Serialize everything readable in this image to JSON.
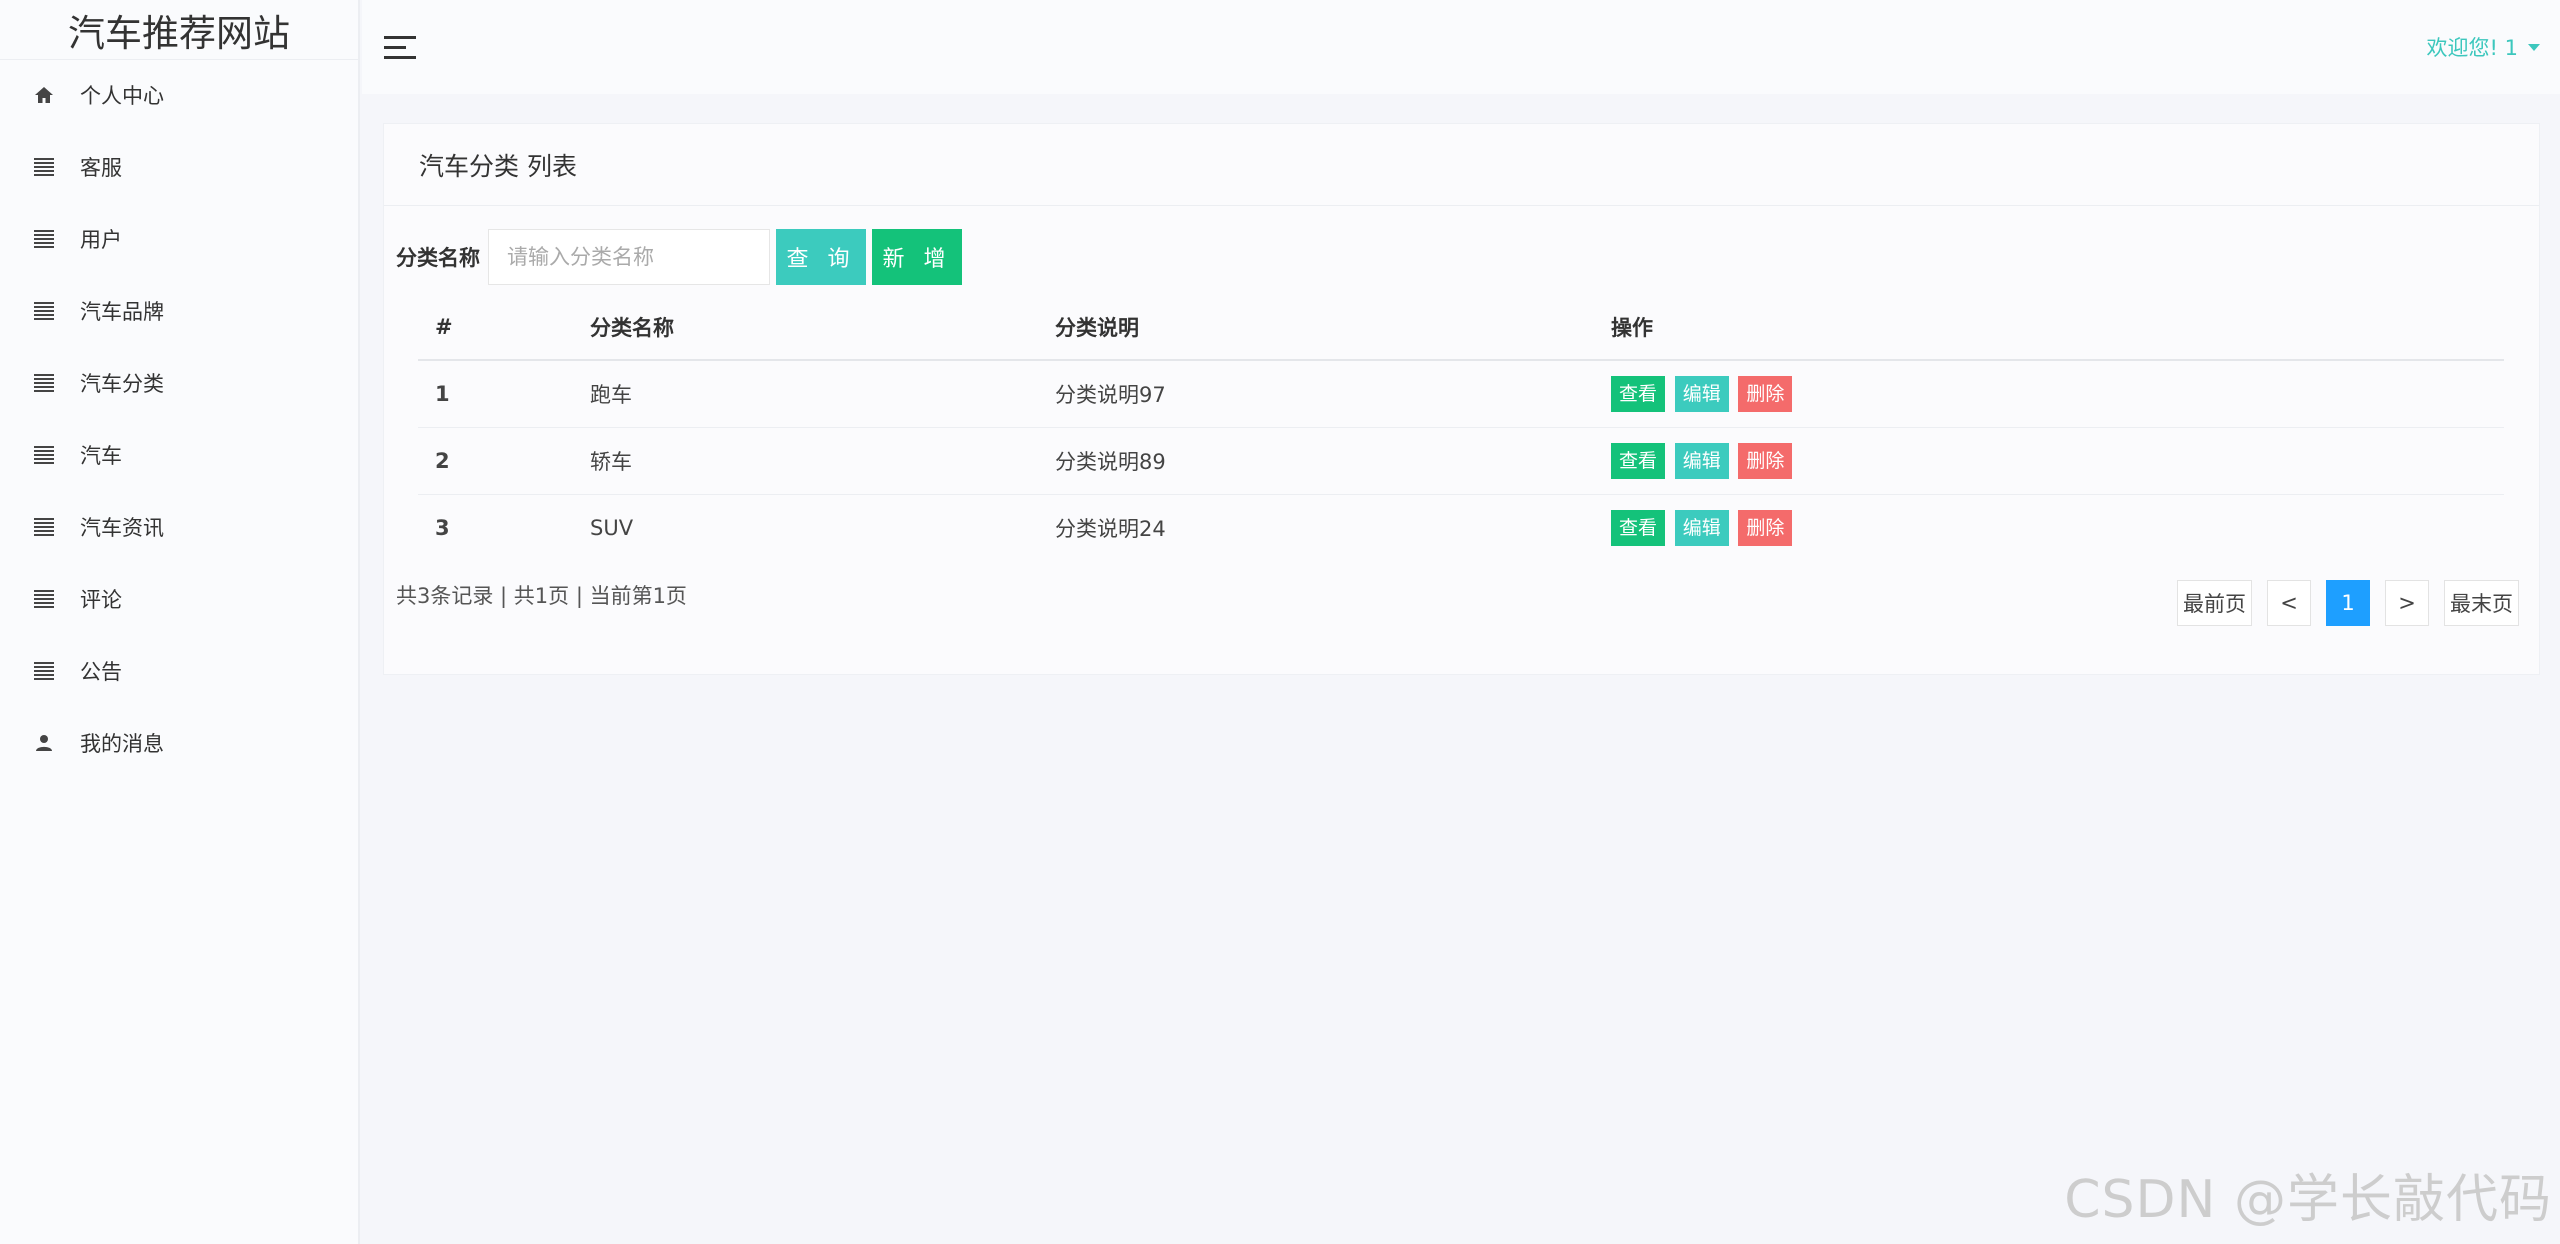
{
  "brand": {
    "title": "汽车推荐网站"
  },
  "sidebar": {
    "items": [
      {
        "label": "个人中心",
        "icon": "home-icon"
      },
      {
        "label": "客服",
        "icon": "list-icon"
      },
      {
        "label": "用户",
        "icon": "list-icon"
      },
      {
        "label": "汽车品牌",
        "icon": "list-icon"
      },
      {
        "label": "汽车分类",
        "icon": "list-icon"
      },
      {
        "label": "汽车",
        "icon": "list-icon"
      },
      {
        "label": "汽车资讯",
        "icon": "list-icon"
      },
      {
        "label": "评论",
        "icon": "list-icon"
      },
      {
        "label": "公告",
        "icon": "list-icon"
      },
      {
        "label": "我的消息",
        "icon": "user-icon"
      }
    ]
  },
  "header": {
    "menu_icon": "hamburger-icon",
    "welcome": "欢迎您! 1",
    "accent": "#3cc7bd"
  },
  "main": {
    "title": "汽车分类 列表",
    "search": {
      "label": "分类名称",
      "placeholder": "请输入分类名称",
      "value": "",
      "query_label": "查 询",
      "add_label": "新 增"
    },
    "table": {
      "headers": [
        "#",
        "分类名称",
        "分类说明",
        "操作"
      ],
      "rows": [
        {
          "idx": "1",
          "name": "跑车",
          "desc": "分类说明97"
        },
        {
          "idx": "2",
          "name": "轿车",
          "desc": "分类说明89"
        },
        {
          "idx": "3",
          "name": "SUV",
          "desc": "分类说明24"
        }
      ],
      "actions": {
        "view": "查看",
        "edit": "编辑",
        "delete": "删除"
      }
    },
    "record_info": "共3条记录 | 共1页 | 当前第1页",
    "pager": {
      "first": "最前页",
      "prev": "<",
      "current": "1",
      "next": ">",
      "last": "最末页"
    }
  },
  "colors": {
    "query": "#3ccbbe",
    "add": "#14c27a",
    "delete": "#f46b6b",
    "active_page": "#1e9fff"
  },
  "watermark": "CSDN @学长敲代码"
}
